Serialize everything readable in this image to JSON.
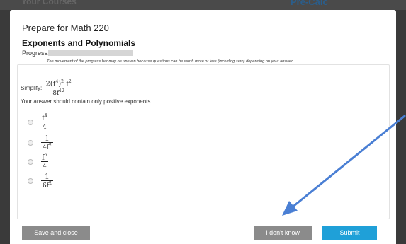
{
  "background": {
    "left_text": "Your Courses",
    "right_text": "Pre-Calc"
  },
  "modal": {
    "title": "Prepare for Math 220",
    "subtitle": "Exponents and Polynomials",
    "progress_label": "Progress:",
    "progress_fraction": 0.0,
    "progress_note": "The movement of the progress bar may be uneven because questions can be worth more or less (including zero) depending on your answer."
  },
  "question": {
    "stem_prefix": "Simplify:",
    "expression": {
      "numerator_left": "2(f",
      "numerator_exp1": "4",
      "numerator_mid": ")",
      "numerator_exp2": "2",
      "numerator_var": "f",
      "numerator_exp3": "2",
      "denominator_base": "8f",
      "denominator_exp": "12"
    },
    "hint": "Your answer should contain only positive exponents.",
    "options": [
      {
        "num_base": "f",
        "num_exp": "4",
        "den_base": "4",
        "den_exp": ""
      },
      {
        "num_base": "1",
        "num_exp": "",
        "den_base": "4f",
        "den_exp": "2"
      },
      {
        "num_base": "f",
        "num_exp": "6",
        "den_base": "4",
        "den_exp": ""
      },
      {
        "num_base": "1",
        "num_exp": "",
        "den_base": "6f",
        "den_exp": "2"
      }
    ]
  },
  "buttons": {
    "save": "Save and close",
    "idk": "I don't know",
    "submit": "Submit"
  },
  "colors": {
    "arrow": "#4a7fd4",
    "submit": "#1fa0d8",
    "gray_button": "#8b8b8b"
  }
}
